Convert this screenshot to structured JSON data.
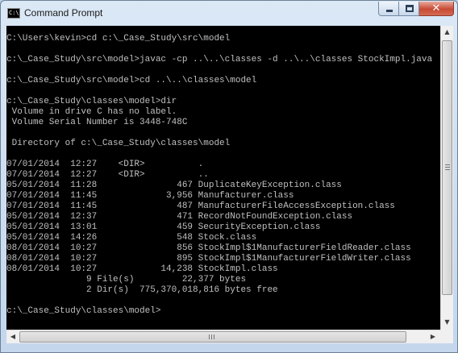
{
  "window": {
    "title": "Command Prompt",
    "icon": "cmd-icon",
    "icon_text": "C:\\"
  },
  "caption_buttons": {
    "minimize_icon": "minimize-icon",
    "maximize_icon": "maximize-icon",
    "close_icon": "close-icon",
    "close_glyph": "✕"
  },
  "console": {
    "background": "#000000",
    "foreground": "#c0c0c0",
    "lines": [
      "C:\\Users\\kevin>cd c:\\_Case_Study\\src\\model",
      "",
      "c:\\_Case_Study\\src\\model>javac -cp ..\\..\\classes -d ..\\..\\classes StockImpl.java",
      "",
      "c:\\_Case_Study\\src\\model>cd ..\\..\\classes\\model",
      "",
      "c:\\_Case_Study\\classes\\model>dir",
      " Volume in drive C has no label.",
      " Volume Serial Number is 3448-748C",
      "",
      " Directory of c:\\_Case_Study\\classes\\model",
      "",
      "07/01/2014  12:27    <DIR>          .",
      "07/01/2014  12:27    <DIR>          ..",
      "05/01/2014  11:28               467 DuplicateKeyException.class",
      "07/01/2014  11:45             3,956 Manufacturer.class",
      "07/01/2014  11:45               487 ManufacturerFileAccessException.class",
      "05/01/2014  12:37               471 RecordNotFoundException.class",
      "05/01/2014  13:01               459 SecurityException.class",
      "05/01/2014  14:26               548 Stock.class",
      "08/01/2014  10:27               856 StockImpl$1ManufacturerFieldReader.class",
      "08/01/2014  10:27               895 StockImpl$1ManufacturerFieldWriter.class",
      "08/01/2014  10:27            14,238 StockImpl.class",
      "               9 File(s)         22,377 bytes",
      "               2 Dir(s)  775,370,018,816 bytes free",
      "",
      "c:\\_Case_Study\\classes\\model>"
    ]
  },
  "scrollbars": {
    "up_arrow": "▲",
    "down_arrow": "▼",
    "left_arrow": "◀",
    "right_arrow": "▶"
  }
}
